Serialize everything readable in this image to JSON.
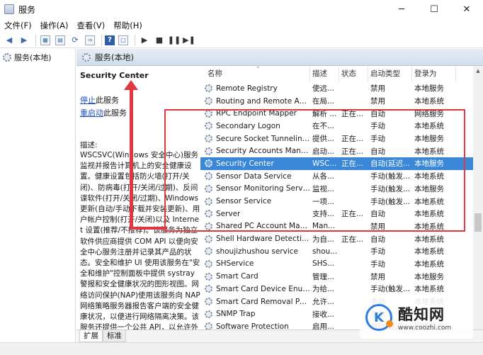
{
  "window": {
    "title": "服务",
    "min_icon": "─",
    "max_icon": "☐",
    "close_icon": "✕"
  },
  "menu": [
    "文件(F)",
    "操作(A)",
    "查看(V)",
    "帮助(H)"
  ],
  "tree": {
    "root_label": "服务(本地)"
  },
  "panel": {
    "header": "服务(本地)"
  },
  "detail": {
    "service_title": "Security Center",
    "stop_link": "停止",
    "stop_suffix": "此服务",
    "restart_link": "重启动",
    "restart_suffix": "此服务",
    "desc_label": "描述:",
    "description": "WSCSVC(Windows 安全中心)服务监视并报告计算机上的安全健康设置。健康设置包括防火墙(打开/关闭)、防病毒(打开/关闭/过期)、反间谍软件(打开/关闭/过期)、Windows 更新(自动/手动下载并安装更新)、用户帐户控制(打开/关闭)以及 Internet 设置(推荐/不推荐)。该服务为独立软件供应商提供 COM API 以便向安全中心服务注册并记录其产品的状态。安全和维护 UI 使用该服务在\"安全和维护\"控制面板中提供 systray 警报和安全健康状况的图形视图。网络访问保护(NAP)使用该服务向 NAP 网络策略服务器报告客户端的安全健康状况，以便进行网络隔离决策。该服务还提供一个公共 API，以允许外部客户以编程方式检索系统的聚合安全健康状况。"
  },
  "columns": {
    "name": "名称",
    "desc": "描述",
    "status": "状态",
    "startup": "启动类型",
    "logon": "登录为"
  },
  "services": [
    {
      "name": "Remote Registry",
      "desc": "使远...",
      "status": "",
      "startup": "禁用",
      "logon": "本地服务",
      "selected": false
    },
    {
      "name": "Routing and Remote Acc...",
      "desc": "在局...",
      "status": "",
      "startup": "禁用",
      "logon": "本地系统",
      "selected": false
    },
    {
      "name": "RPC Endpoint Mapper",
      "desc": "解析 ...",
      "status": "正在...",
      "startup": "自动",
      "logon": "网络服务",
      "selected": false
    },
    {
      "name": "Secondary Logon",
      "desc": "在不...",
      "status": "",
      "startup": "手动",
      "logon": "本地系统",
      "selected": false
    },
    {
      "name": "Secure Socket Tunneling ...",
      "desc": "提供...",
      "status": "正在...",
      "startup": "手动",
      "logon": "本地服务",
      "selected": false
    },
    {
      "name": "Security Accounts Manag...",
      "desc": "启动...",
      "status": "正在...",
      "startup": "自动",
      "logon": "本地系统",
      "selected": false
    },
    {
      "name": "Security Center",
      "desc": "WSC...",
      "status": "正在...",
      "startup": "自动(延迟...",
      "logon": "本地服务",
      "selected": true
    },
    {
      "name": "Sensor Data Service",
      "desc": "从各...",
      "status": "",
      "startup": "手动(触发...",
      "logon": "本地系统",
      "selected": false
    },
    {
      "name": "Sensor Monitoring Service",
      "desc": "监视...",
      "status": "",
      "startup": "手动(触发...",
      "logon": "本地服务",
      "selected": false
    },
    {
      "name": "Sensor Service",
      "desc": "一项...",
      "status": "",
      "startup": "手动(触发...",
      "logon": "本地系统",
      "selected": false
    },
    {
      "name": "Server",
      "desc": "支持...",
      "status": "正在...",
      "startup": "自动",
      "logon": "本地系统",
      "selected": false
    },
    {
      "name": "Shared PC Account Mana...",
      "desc": "Man...",
      "status": "",
      "startup": "禁用",
      "logon": "本地系统",
      "selected": false
    },
    {
      "name": "Shell Hardware Detection",
      "desc": "为自...",
      "status": "正在...",
      "startup": "自动",
      "logon": "本地系统",
      "selected": false
    },
    {
      "name": "shoujizhushou service",
      "desc": "shou...",
      "status": "",
      "startup": "手动",
      "logon": "本地系统",
      "selected": false
    },
    {
      "name": "SHService",
      "desc": "SHS...",
      "status": "",
      "startup": "手动",
      "logon": "本地系统",
      "selected": false
    },
    {
      "name": "Smart Card",
      "desc": "管理...",
      "status": "",
      "startup": "禁用",
      "logon": "本地服务",
      "selected": false
    },
    {
      "name": "Smart Card Device Enum...",
      "desc": "为给...",
      "status": "",
      "startup": "手动(触发...",
      "logon": "本地系统",
      "selected": false
    },
    {
      "name": "Smart Card Removal Poli...",
      "desc": "允许...",
      "status": "",
      "startup": "手动",
      "logon": "本地系统",
      "selected": false
    },
    {
      "name": "SNMP Trap",
      "desc": "接收...",
      "status": "",
      "startup": "手动",
      "logon": "本地服务",
      "selected": false
    },
    {
      "name": "Software Protection",
      "desc": "启用...",
      "status": "",
      "startup": "自动(延迟...",
      "logon": "网络服务",
      "selected": false
    }
  ],
  "tabs": [
    "扩展",
    "标准"
  ],
  "watermark": {
    "brand": "酷知网",
    "url": "www.coozhi.com",
    "logo_letter": "K"
  },
  "colors": {
    "selection": "#3a87d8",
    "highlight_box": "#e0383e",
    "link": "#1f53c2"
  }
}
